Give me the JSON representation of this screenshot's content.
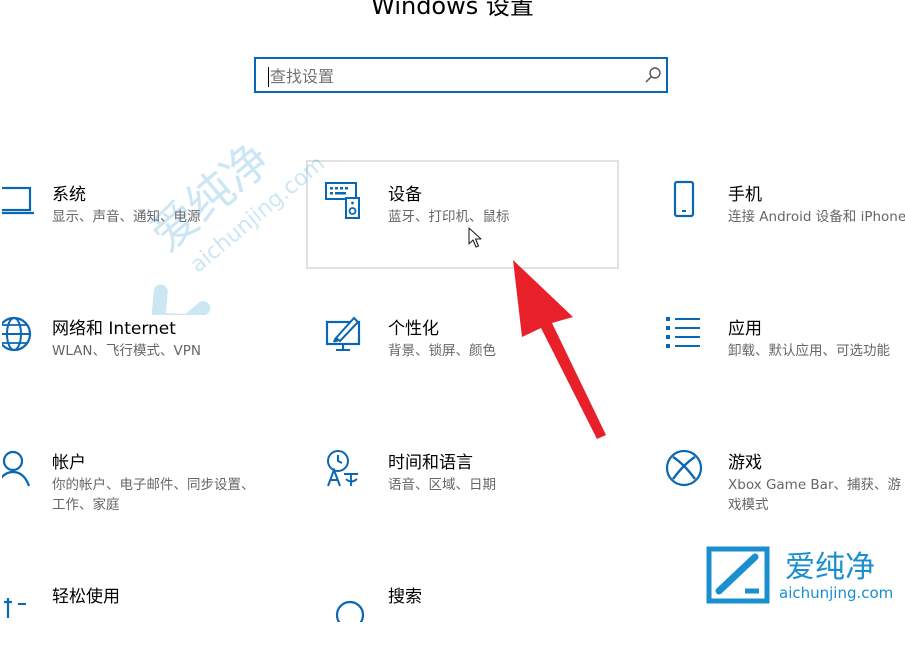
{
  "header": {
    "title": "Windows 设置"
  },
  "search": {
    "placeholder": "查找设置"
  },
  "tiles": [
    {
      "title": "系统",
      "desc": "显示、声音、通知、电源",
      "icon": "laptop-icon"
    },
    {
      "title": "设备",
      "desc": "蓝牙、打印机、鼠标",
      "icon": "devices-icon"
    },
    {
      "title": "手机",
      "desc": "连接 Android 设备和 iPhone",
      "icon": "phone-icon"
    },
    {
      "title": "网络和 Internet",
      "desc": "WLAN、飞行模式、VPN",
      "icon": "globe-icon"
    },
    {
      "title": "个性化",
      "desc": "背景、锁屏、颜色",
      "icon": "paintbrush-monitor-icon"
    },
    {
      "title": "应用",
      "desc": "卸载、默认应用、可选功能",
      "icon": "apps-list-icon"
    },
    {
      "title": "帐户",
      "desc": "你的帐户、电子邮件、同步设置、工作、家庭",
      "icon": "person-icon"
    },
    {
      "title": "时间和语言",
      "desc": "语音、区域、日期",
      "icon": "time-language-icon"
    },
    {
      "title": "游戏",
      "desc": "Xbox Game Bar、捕获、游戏模式",
      "icon": "xbox-icon"
    },
    {
      "title": "轻松使用",
      "desc": "",
      "icon": "ease-of-access-icon"
    },
    {
      "title": "搜索",
      "desc": "",
      "icon": "search-circle-icon"
    }
  ],
  "watermark": {
    "brand": "爱纯净",
    "domain": "aichunjing.com"
  },
  "colors": {
    "accent": "#0a67b3",
    "annotation_arrow": "#e8202a",
    "watermark": "#1a8fd0"
  }
}
